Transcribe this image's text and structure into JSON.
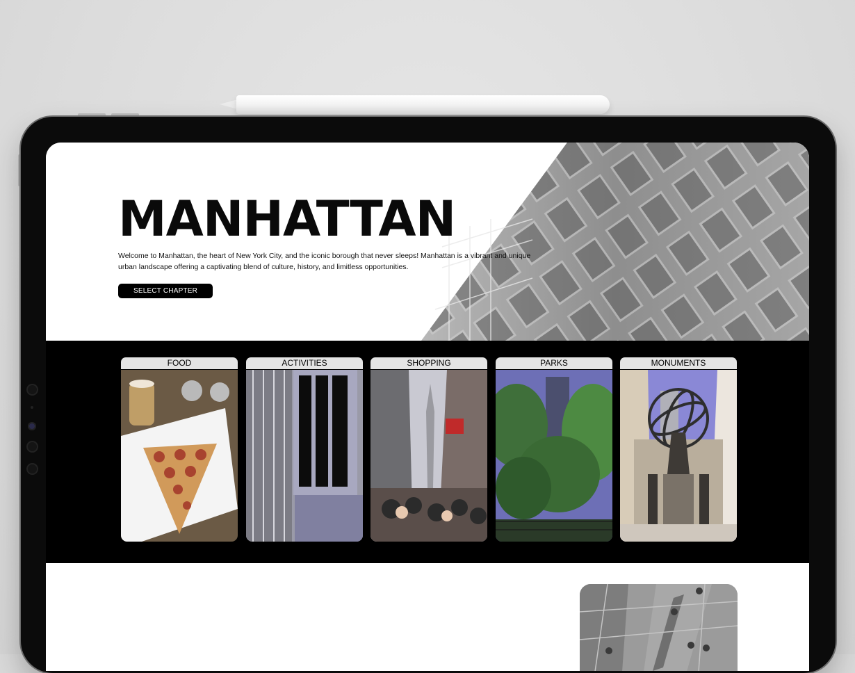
{
  "hero": {
    "title": "MANHATTAN",
    "description": "Welcome to Manhattan, the heart of New York City, and the iconic borough that never sleeps! Manhattan is a vibrant and unique urban landscape offering a captivating blend of culture, history, and limitless opportunities.",
    "button_label": "SELECT CHAPTER"
  },
  "categories": [
    {
      "label": "FOOD"
    },
    {
      "label": "ACTIVITIES"
    },
    {
      "label": "SHOPPING"
    },
    {
      "label": "PARKS"
    },
    {
      "label": "MONUMENTS"
    }
  ],
  "colors": {
    "background": "#dcdcdc",
    "bezel": "#0b0b0b",
    "band": "#000000",
    "label_bg": "#e4e4e4",
    "button_bg": "#000000"
  }
}
